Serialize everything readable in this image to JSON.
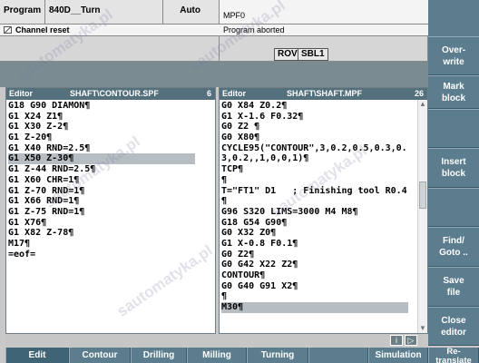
{
  "header": {
    "area": "Program",
    "channel": "840D__Turn",
    "mode": "Auto",
    "program": "MPF0",
    "alarm": "Channel reset",
    "prog_status": "Program aborted",
    "flags": [
      "ROV",
      "SBL1"
    ]
  },
  "editor_left": {
    "title": "Editor",
    "file": "SHAFT\\CONTOUR.SPF",
    "count": "6",
    "lines": [
      "G18 G90 DIAMON¶",
      "G1 X24 Z1¶",
      "G1 X30 Z-2¶",
      "G1 Z-20¶",
      "G1 X40 RND=2.5¶",
      "G1 X50 Z-30¶",
      "G1 Z-44 RND=2.5¶",
      "G1 X60 CHR=1¶",
      "G1 Z-70 RND=1¶",
      "G1 X66 RND=1¶",
      "G1 Z-75 RND=1¶",
      "G1 X76¶",
      "G1 X82 Z-78¶",
      "M17¶",
      "=eof="
    ],
    "selected_line": 5
  },
  "editor_right": {
    "title": "Editor",
    "file": "SHAFT\\SHAFT.MPF",
    "count": "26",
    "lines": [
      "G0 X84 Z0.2¶",
      "G1 X-1.6 F0.32¶",
      "G0 Z2 ¶",
      "G0 X80¶",
      "CYCLE95(\"CONTOUR\",3,0.2,0.5,0.3,0.",
      "3,0.2,,1,0,0,1)¶",
      "TCP¶",
      "¶",
      "T=\"FT1\" D1   ; Finishing tool R0.4",
      "¶",
      "G96 S320 LIMS=3000 M4 M8¶",
      "G18 G54 G90¶",
      "G0 X32 Z0¶",
      "G1 X-0.8 F0.1¶",
      "G0 Z2¶",
      "G0 G42 X22 Z2¶",
      "CONTOUR¶",
      "G0 G40 G91 X2¶",
      "¶",
      "M30¶"
    ],
    "selected_line": 19
  },
  "status_buttons": [
    "i",
    "▷"
  ],
  "right_softkeys": [
    {
      "label": "Over-\nwrite"
    },
    {
      "label": "Mark\nblock"
    },
    {
      "label": ""
    },
    {
      "label": "Insert\nblock"
    },
    {
      "label": ""
    },
    {
      "label": "Find/\nGoto .."
    },
    {
      "label": "Save\nfile"
    },
    {
      "label": "Close\neditor"
    }
  ],
  "bottom_softkeys": [
    {
      "label": "Edit",
      "active": true
    },
    {
      "label": "Contour",
      "active": false
    },
    {
      "label": "Drilling",
      "active": false
    },
    {
      "label": "Milling",
      "active": false
    },
    {
      "label": "Turning",
      "active": false
    },
    {
      "label": "",
      "active": false
    },
    {
      "label": "Simulation",
      "active": false
    },
    {
      "label": "Re-\ntranslate",
      "active": false
    }
  ],
  "watermark": "sautomatyka.pl",
  "colors": {
    "softkey": "#5b7d8e",
    "pane_title": "#54707c",
    "selection": "#b7bec3"
  }
}
